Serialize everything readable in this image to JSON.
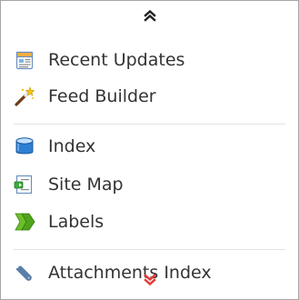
{
  "menu": {
    "scroll_up_icon": "double-chevron-up-icon",
    "scroll_down_icon": "double-chevron-down-icon",
    "items": [
      {
        "label": "Recent Updates",
        "icon": "page-icon"
      },
      {
        "label": "Feed Builder",
        "icon": "magic-wand-icon"
      },
      {
        "label": "Index",
        "icon": "database-icon"
      },
      {
        "label": "Site Map",
        "icon": "sitemap-icon"
      },
      {
        "label": "Labels",
        "icon": "label-tag-icon"
      },
      {
        "label": "Attachments Index",
        "icon": "paperclip-icon"
      }
    ]
  },
  "colors": {
    "text": "#333333",
    "border": "#a5a5a5",
    "separator": "#e3e3e3",
    "scroll_up_arrow": "#222222",
    "scroll_down_arrow": "#e53935"
  }
}
